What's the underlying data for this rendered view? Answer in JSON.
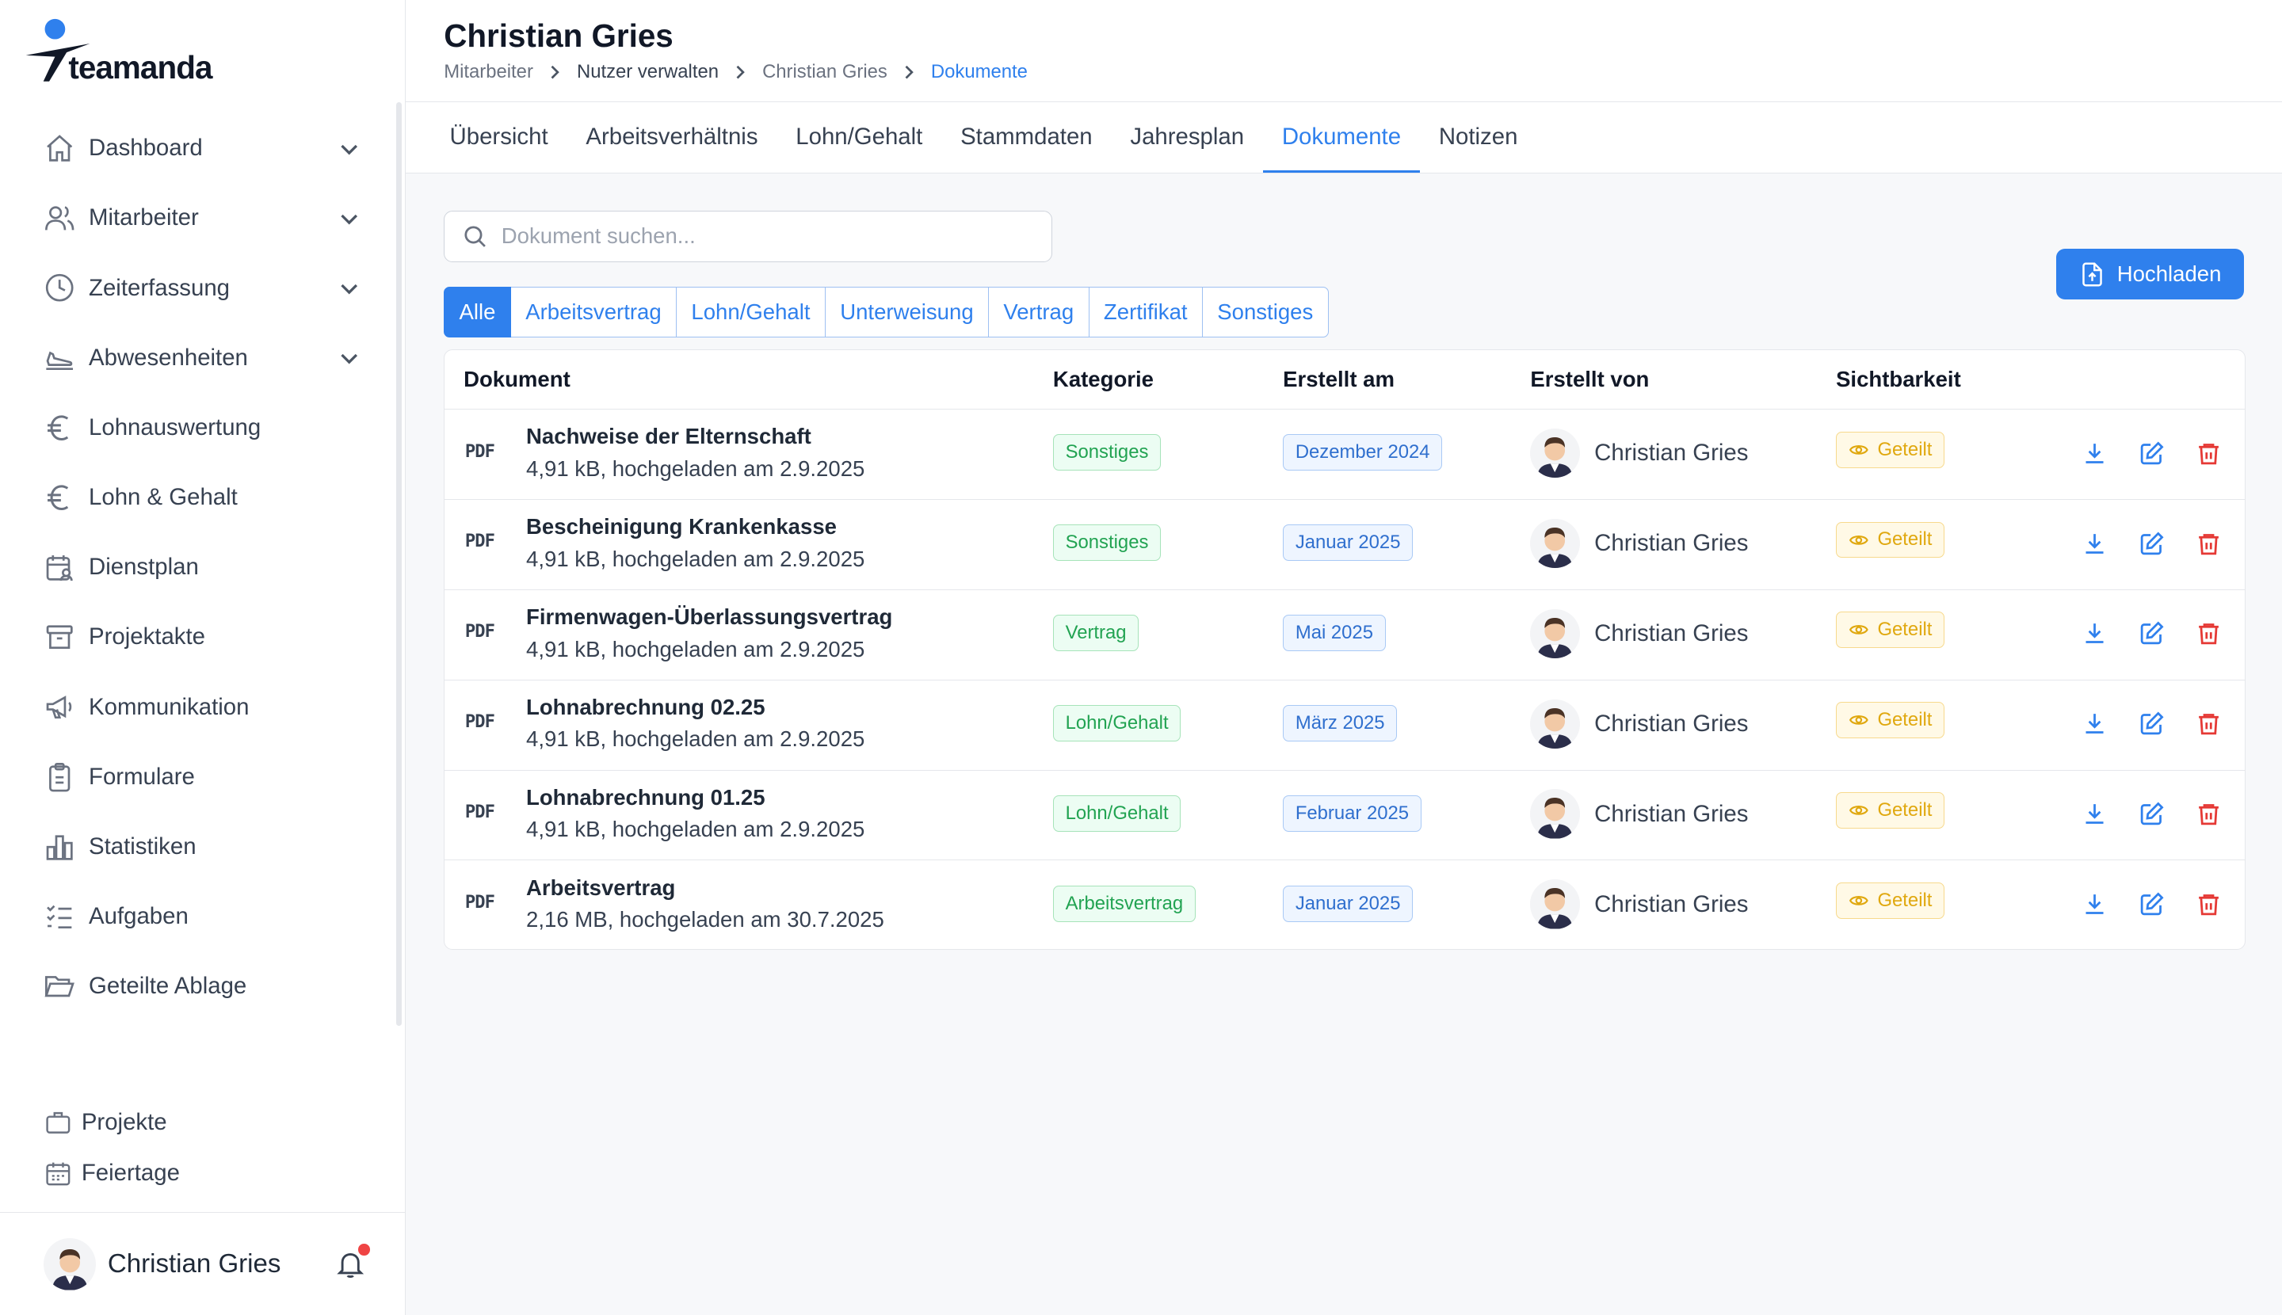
{
  "brand": {
    "name": "teamanda"
  },
  "sidebar": {
    "items": [
      {
        "label": "Dashboard",
        "icon": "home-icon",
        "expandable": true
      },
      {
        "label": "Mitarbeiter",
        "icon": "users-icon",
        "expandable": true
      },
      {
        "label": "Zeiterfassung",
        "icon": "clock-icon",
        "expandable": true
      },
      {
        "label": "Abwesenheiten",
        "icon": "plane-icon",
        "expandable": true
      },
      {
        "label": "Lohnauswertung",
        "icon": "euro-icon",
        "expandable": false
      },
      {
        "label": "Lohn & Gehalt",
        "icon": "euro-icon",
        "expandable": false
      },
      {
        "label": "Dienstplan",
        "icon": "calendar-user-icon",
        "expandable": false
      },
      {
        "label": "Projektakte",
        "icon": "archive-icon",
        "expandable": false
      },
      {
        "label": "Kommunikation",
        "icon": "megaphone-icon",
        "expandable": false
      },
      {
        "label": "Formulare",
        "icon": "clipboard-icon",
        "expandable": false
      },
      {
        "label": "Statistiken",
        "icon": "bar-chart-icon",
        "expandable": false
      },
      {
        "label": "Aufgaben",
        "icon": "checklist-icon",
        "expandable": false
      },
      {
        "label": "Geteilte Ablage",
        "icon": "folder-open-icon",
        "expandable": false
      }
    ],
    "secondary": [
      {
        "label": "Projekte",
        "icon": "briefcase-icon"
      },
      {
        "label": "Feiertage",
        "icon": "calendar-icon"
      }
    ],
    "user": {
      "name": "Christian Gries"
    }
  },
  "header": {
    "title": "Christian Gries",
    "breadcrumb": [
      "Mitarbeiter",
      "Nutzer verwalten",
      "Christian Gries",
      "Dokumente"
    ]
  },
  "tabs": [
    "Übersicht",
    "Arbeitsverhältnis",
    "Lohn/Gehalt",
    "Stammdaten",
    "Jahresplan",
    "Dokumente",
    "Notizen"
  ],
  "active_tab": "Dokumente",
  "search": {
    "placeholder": "Dokument suchen...",
    "value": ""
  },
  "upload_button": {
    "label": "Hochladen"
  },
  "filters": [
    "Alle",
    "Arbeitsvertrag",
    "Lohn/Gehalt",
    "Unterweisung",
    "Vertrag",
    "Zertifikat",
    "Sonstiges"
  ],
  "active_filter": "Alle",
  "table": {
    "columns": [
      "Dokument",
      "Kategorie",
      "Erstellt am",
      "Erstellt von",
      "Sichtbarkeit"
    ],
    "rows": [
      {
        "type": "PDF",
        "name": "Nachweise der Elternschaft",
        "meta": "4,91 kB, hochgeladen am 2.9.2025",
        "category": "Sonstiges",
        "created": "Dezember 2024",
        "creator": "Christian Gries",
        "visibility": "Geteilt"
      },
      {
        "type": "PDF",
        "name": "Bescheinigung Krankenkasse",
        "meta": "4,91 kB, hochgeladen am 2.9.2025",
        "category": "Sonstiges",
        "created": "Januar 2025",
        "creator": "Christian Gries",
        "visibility": "Geteilt"
      },
      {
        "type": "PDF",
        "name": "Firmenwagen-Überlassungsvertrag",
        "meta": "4,91 kB, hochgeladen am 2.9.2025",
        "category": "Vertrag",
        "created": "Mai 2025",
        "creator": "Christian Gries",
        "visibility": "Geteilt"
      },
      {
        "type": "PDF",
        "name": "Lohnabrechnung 02.25",
        "meta": "4,91 kB, hochgeladen am 2.9.2025",
        "category": "Lohn/Gehalt",
        "created": "März 2025",
        "creator": "Christian Gries",
        "visibility": "Geteilt"
      },
      {
        "type": "PDF",
        "name": "Lohnabrechnung 01.25",
        "meta": "4,91 kB, hochgeladen am 2.9.2025",
        "category": "Lohn/Gehalt",
        "created": "Februar 2025",
        "creator": "Christian Gries",
        "visibility": "Geteilt"
      },
      {
        "type": "PDF",
        "name": "Arbeitsvertrag",
        "meta": "2,16 MB, hochgeladen am 30.7.2025",
        "category": "Arbeitsvertrag",
        "created": "Januar 2025",
        "creator": "Christian Gries",
        "visibility": "Geteilt"
      }
    ]
  },
  "colors": {
    "accent": "#2f80ed",
    "danger": "#e53935",
    "success": "#22a352",
    "warning": "#e0a80f"
  }
}
